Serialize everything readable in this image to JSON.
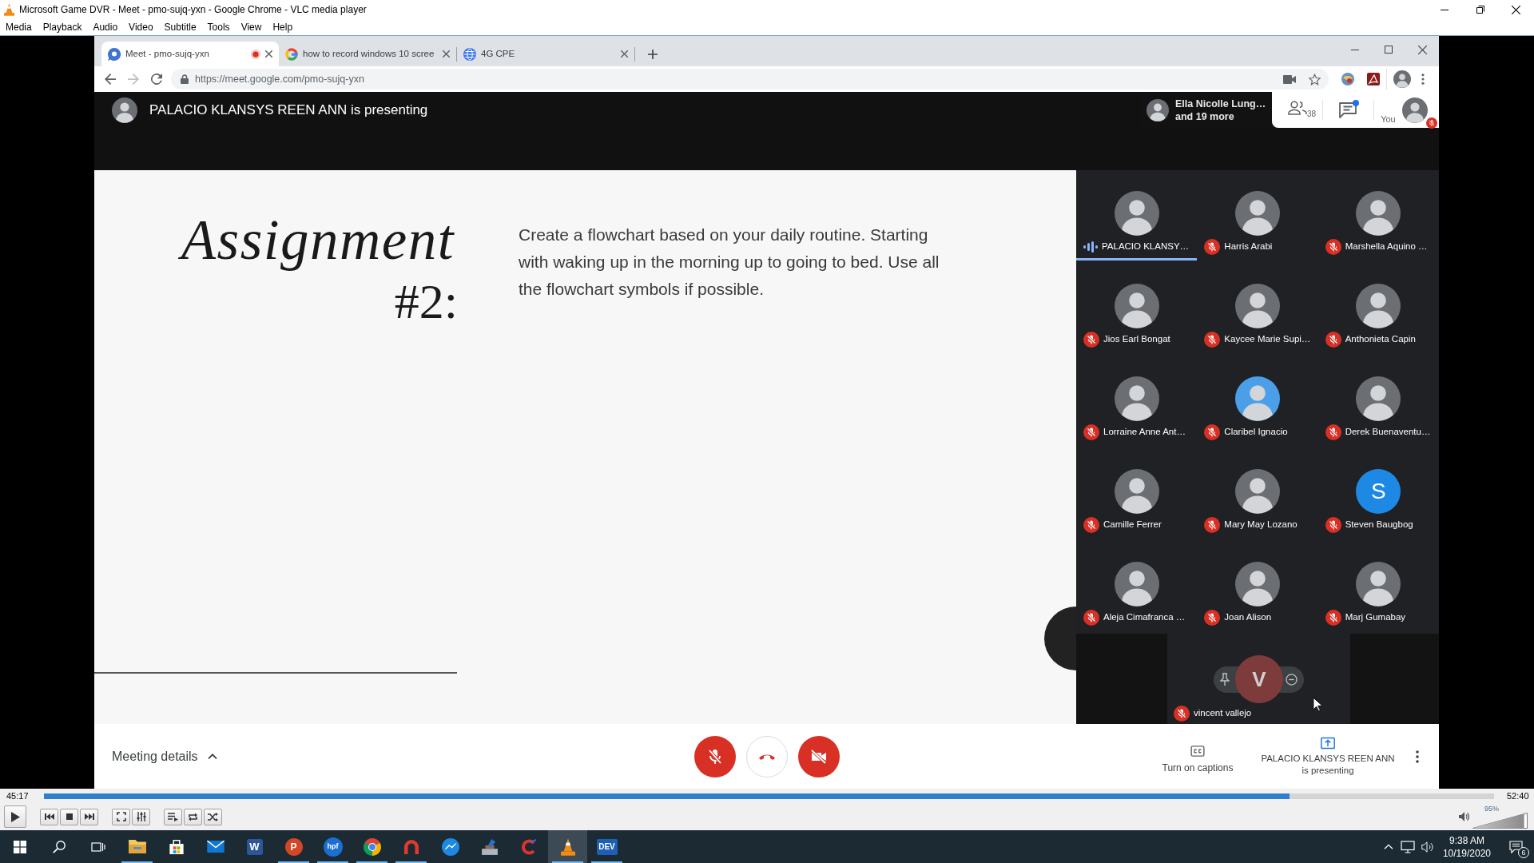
{
  "window": {
    "title": "Microsoft Game DVR - Meet - pmo-sujq-yxn - Google Chrome - VLC media player"
  },
  "menu": [
    "Media",
    "Playback",
    "Audio",
    "Video",
    "Subtitle",
    "Tools",
    "View",
    "Help"
  ],
  "browser": {
    "tabs": [
      {
        "title": "Meet - pmo-sujq-yxn",
        "kind": "meet",
        "recording": true,
        "selected": true
      },
      {
        "title": "how to record windows 10 scree",
        "kind": "google",
        "recording": false,
        "selected": false
      },
      {
        "title": "4G CPE",
        "kind": "globe",
        "recording": false,
        "selected": false
      }
    ],
    "url": "https://meet.google.com/pmo-sujq-yxn"
  },
  "meet": {
    "presenting_banner": "PALACIO KLANSYS REEN ANN is presenting",
    "others": {
      "name": "Ella Nicolle Lung…",
      "more": "and 19 more"
    },
    "people_count": "38",
    "chat_unread": true,
    "self": {
      "label": "You",
      "muted": true
    },
    "slide": {
      "title": "Assignment",
      "number": "#2:",
      "body": "Create a flowchart based on your daily routine. Starting with waking up in the morning up to going to bed. Use all the flowchart symbols if possible."
    },
    "participant_rows": [
      [
        {
          "name": "PALACIO KLANSY…",
          "speaking": true,
          "muted": false,
          "avatar": {
            "kind": "photo"
          }
        },
        {
          "name": "Harris Arabi",
          "speaking": false,
          "muted": true,
          "avatar": {
            "kind": "photo"
          }
        },
        {
          "name": "Marshella Aquino …",
          "speaking": false,
          "muted": true,
          "avatar": {
            "kind": "photo"
          }
        }
      ],
      [
        {
          "name": "Jios Earl Bongat",
          "speaking": false,
          "muted": true,
          "avatar": {
            "kind": "photo"
          }
        },
        {
          "name": "Kaycee Marie Supi…",
          "speaking": false,
          "muted": true,
          "avatar": {
            "kind": "photo"
          }
        },
        {
          "name": "Anthonieta Capin",
          "speaking": false,
          "muted": true,
          "avatar": {
            "kind": "photo"
          }
        }
      ],
      [
        {
          "name": "Lorraine Anne Ant…",
          "speaking": false,
          "muted": true,
          "avatar": {
            "kind": "photo"
          }
        },
        {
          "name": "Claribel Ignacio",
          "speaking": false,
          "muted": true,
          "avatar": {
            "kind": "photo",
            "color": "#4a9fe8"
          }
        },
        {
          "name": "Derek Buenaventu…",
          "speaking": false,
          "muted": true,
          "avatar": {
            "kind": "photo"
          }
        }
      ],
      [
        {
          "name": "Camille Ferrer",
          "speaking": false,
          "muted": true,
          "avatar": {
            "kind": "photo"
          }
        },
        {
          "name": "Mary May Lozano",
          "speaking": false,
          "muted": true,
          "avatar": {
            "kind": "photo"
          }
        },
        {
          "name": "Steven Baugbog",
          "speaking": false,
          "muted": true,
          "avatar": {
            "kind": "initial",
            "initial": "S",
            "color": "#1e88e5"
          }
        }
      ],
      [
        {
          "name": "Aleja Cimafranca …",
          "speaking": false,
          "muted": true,
          "avatar": {
            "kind": "photo"
          }
        },
        {
          "name": "Joan Alison",
          "speaking": false,
          "muted": true,
          "avatar": {
            "kind": "photo"
          }
        },
        {
          "name": "Marj Gumabay",
          "speaking": false,
          "muted": true,
          "avatar": {
            "kind": "photo"
          }
        }
      ]
    ],
    "focused_tile": {
      "name": "vincent vallejo",
      "initial": "V",
      "muted": true,
      "hover": true
    },
    "controls": {
      "meeting_details": "Meeting details",
      "mic_on": false,
      "camera_on": false,
      "captions": "Turn on captions",
      "presenting": "PALACIO KLANSYS REEN ANN is presenting"
    }
  },
  "player": {
    "elapsed": "45:17",
    "total": "52:40",
    "level": 0.859,
    "volume": {
      "level": 0.95,
      "reading": "95%"
    }
  },
  "taskbar": {
    "apps": [
      {
        "kind": "explorer",
        "running": true,
        "selected": false
      },
      {
        "kind": "store",
        "running": false,
        "selected": false
      },
      {
        "kind": "mail",
        "running": false,
        "selected": false
      },
      {
        "kind": "word",
        "glyph": "W",
        "running": false,
        "selected": false
      },
      {
        "kind": "powerpoint",
        "glyph": "P",
        "running": true,
        "selected": false
      },
      {
        "kind": "hpf",
        "glyph": "hpf",
        "running": true,
        "selected": false
      },
      {
        "kind": "chrome",
        "running": true,
        "selected": false
      },
      {
        "kind": "arc",
        "running": true,
        "selected": false
      },
      {
        "kind": "messenger",
        "running": false,
        "selected": false
      },
      {
        "kind": "tool",
        "running": false,
        "selected": false
      },
      {
        "kind": "ccleaner",
        "running": false,
        "selected": false
      },
      {
        "kind": "vlc",
        "running": true,
        "selected": true
      },
      {
        "kind": "dev",
        "glyph": "DEV",
        "running": true,
        "selected": false
      }
    ],
    "time": "9:38 AM",
    "date": "10/19/2020",
    "notifications": "6"
  }
}
